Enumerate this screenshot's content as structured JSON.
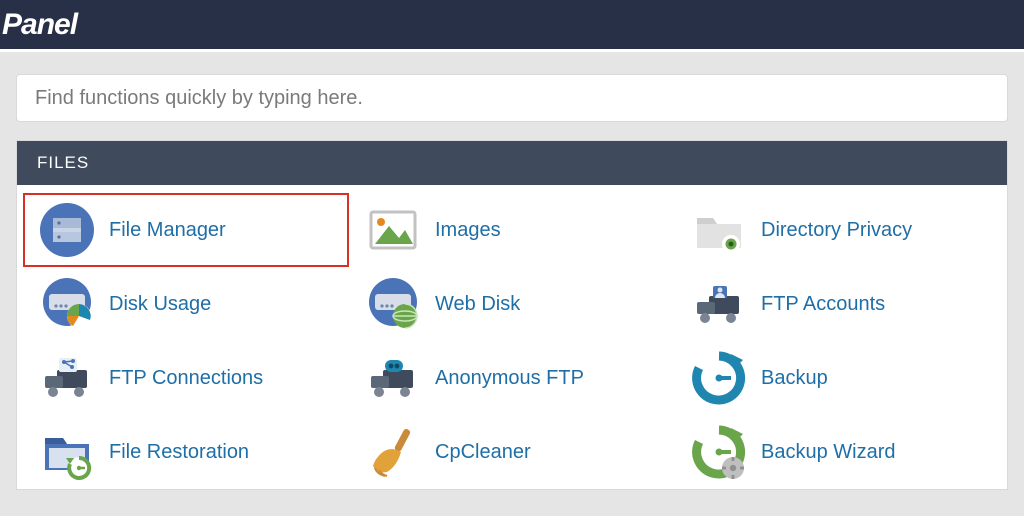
{
  "brand": {
    "logo_text": "Panel"
  },
  "search": {
    "placeholder": "Find functions quickly by typing here."
  },
  "panel": {
    "title": "FILES",
    "items": [
      {
        "id": "file-manager",
        "label": "File Manager",
        "icon": "file-manager-icon",
        "highlighted": true
      },
      {
        "id": "images",
        "label": "Images",
        "icon": "images-icon",
        "highlighted": false
      },
      {
        "id": "directory-privacy",
        "label": "Directory Privacy",
        "icon": "directory-privacy-icon",
        "highlighted": false
      },
      {
        "id": "disk-usage",
        "label": "Disk Usage",
        "icon": "disk-usage-icon",
        "highlighted": false
      },
      {
        "id": "web-disk",
        "label": "Web Disk",
        "icon": "web-disk-icon",
        "highlighted": false
      },
      {
        "id": "ftp-accounts",
        "label": "FTP Accounts",
        "icon": "ftp-accounts-icon",
        "highlighted": false
      },
      {
        "id": "ftp-connections",
        "label": "FTP Connections",
        "icon": "ftp-connections-icon",
        "highlighted": false
      },
      {
        "id": "anonymous-ftp",
        "label": "Anonymous FTP",
        "icon": "anonymous-ftp-icon",
        "highlighted": false
      },
      {
        "id": "backup",
        "label": "Backup",
        "icon": "backup-icon",
        "highlighted": false
      },
      {
        "id": "file-restoration",
        "label": "File Restoration",
        "icon": "file-restoration-icon",
        "highlighted": false
      },
      {
        "id": "cpcleaner",
        "label": "CpCleaner",
        "icon": "cpcleaner-icon",
        "highlighted": false
      },
      {
        "id": "backup-wizard",
        "label": "Backup Wizard",
        "icon": "backup-wizard-icon",
        "highlighted": false
      }
    ]
  },
  "colors": {
    "link": "#1e6ea7",
    "header_bg": "#3f4a5c",
    "topbar_bg": "#283048",
    "highlight": "#d93025",
    "blue": "#4a73b8",
    "green": "#6aa44b",
    "orange": "#e28a1e"
  }
}
